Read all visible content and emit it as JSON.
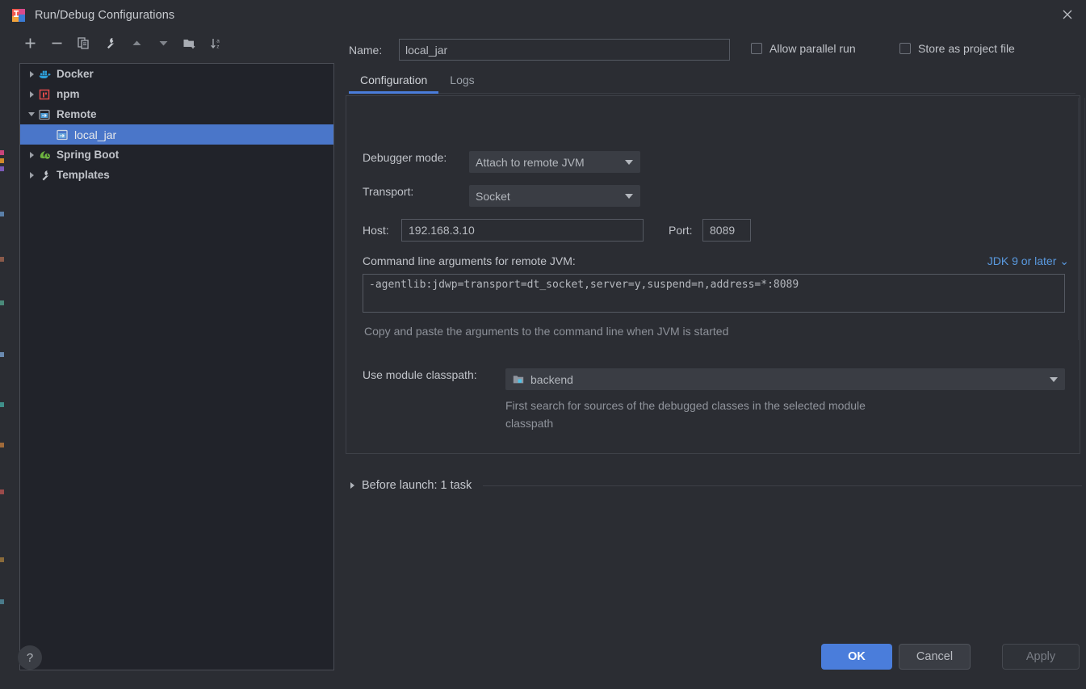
{
  "window": {
    "title": "Run/Debug Configurations",
    "app_icon": "intellij-idea-logo",
    "close_icon": "close-icon"
  },
  "toolbar": {
    "buttons": [
      {
        "name": "add-configuration-button",
        "icon": "plus-icon",
        "glyph": "+",
        "enabled": true
      },
      {
        "name": "remove-configuration-button",
        "icon": "minus-icon",
        "glyph": "−",
        "enabled": true
      },
      {
        "name": "copy-configuration-button",
        "icon": "copy-icon",
        "glyph": "❐",
        "enabled": true
      },
      {
        "name": "edit-templates-button",
        "icon": "wrench-icon",
        "glyph": "🔧",
        "enabled": true
      },
      {
        "name": "move-up-button",
        "icon": "arrow-up-icon",
        "glyph": "▲",
        "enabled": true
      },
      {
        "name": "move-down-button",
        "icon": "arrow-down-icon",
        "glyph": "▼",
        "enabled": true
      },
      {
        "name": "new-folder-button",
        "icon": "folder-add-icon",
        "glyph": "📁",
        "enabled": true
      },
      {
        "name": "sort-configurations-button",
        "icon": "sort-alphabetical-icon",
        "glyph": "↓",
        "enabled": true
      }
    ]
  },
  "tree": {
    "items": [
      {
        "label": "Docker",
        "icon": "docker-icon",
        "expandable": true,
        "expanded": false,
        "selected": false,
        "child": false
      },
      {
        "label": "npm",
        "icon": "npm-icon",
        "expandable": true,
        "expanded": false,
        "selected": false,
        "child": false
      },
      {
        "label": "Remote",
        "icon": "remote-jvm-icon",
        "expandable": true,
        "expanded": true,
        "selected": false,
        "child": false
      },
      {
        "label": "local_jar",
        "icon": "remote-jvm-icon",
        "expandable": false,
        "expanded": false,
        "selected": true,
        "child": true
      },
      {
        "label": "Spring Boot",
        "icon": "spring-boot-icon",
        "expandable": true,
        "expanded": false,
        "selected": false,
        "child": false
      },
      {
        "label": "Templates",
        "icon": "wrench-icon",
        "expandable": true,
        "expanded": false,
        "selected": false,
        "child": false
      }
    ]
  },
  "header": {
    "name_label": "Name:",
    "name_value": "local_jar",
    "name_placeholder": "",
    "allow_parallel_run": {
      "label": "Allow parallel run",
      "checked": false
    },
    "store_as_project_file": {
      "label": "Store as project file",
      "checked": false
    },
    "gear_icon": "gear-icon"
  },
  "tabs": [
    {
      "label": "Configuration",
      "active": true
    },
    {
      "label": "Logs",
      "active": false
    }
  ],
  "configuration": {
    "debugger_mode": {
      "label": "Debugger mode:",
      "value": "Attach to remote JVM"
    },
    "transport": {
      "label": "Transport:",
      "value": "Socket"
    },
    "host": {
      "label": "Host:",
      "value": "192.168.3.10"
    },
    "port": {
      "label": "Port:",
      "value": "8089"
    },
    "args": {
      "label": "Command line arguments for remote JVM:",
      "jdk_selector": "JDK 9 or later",
      "value": "-agentlib:jdwp=transport=dt_socket,server=y,suspend=n,address=*:8089",
      "hint": "Copy and paste the arguments to the command line when JVM is started"
    },
    "module_classpath": {
      "label": "Use module classpath:",
      "value": "backend",
      "icon": "module-icon",
      "hint": "First search for sources of the debugged classes in the selected module classpath"
    }
  },
  "before_launch": {
    "label": "Before launch: 1 task",
    "expanded": false
  },
  "footer": {
    "help_label": "?",
    "ok_label": "OK",
    "cancel_label": "Cancel",
    "apply_label": "Apply",
    "apply_enabled": false
  },
  "colors": {
    "accent": "#4a7ddb",
    "selection": "#4a76c9",
    "dialog_bg": "#2b2d33",
    "tree_bg": "#21232a",
    "link": "#5a9ae0",
    "text": "#c0c3c9",
    "muted_text": "#90949c"
  }
}
